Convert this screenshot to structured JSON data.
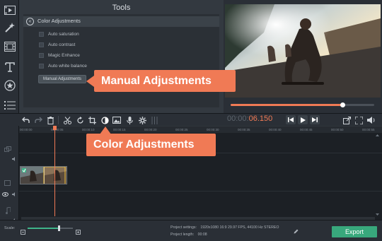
{
  "tools_panel": {
    "title": "Tools",
    "section_title": "Color Adjustments",
    "checkboxes": [
      {
        "label": "Auto saturation",
        "checked": false
      },
      {
        "label": "Auto contrast",
        "checked": false
      },
      {
        "label": "Magic Enhance",
        "checked": false
      },
      {
        "label": "Auto white balance",
        "checked": false
      }
    ],
    "manual_button_label": "Manual Adjustments"
  },
  "left_toolbar": {
    "icons": [
      "film-import-icon",
      "magic-wand-icon",
      "filmstrip-icon",
      "text-icon",
      "star-icon",
      "list-icon"
    ]
  },
  "preview": {
    "seek_progress": 0.78
  },
  "edit_toolbar": {
    "time_prefix": "00:00:",
    "time_value": "06.150"
  },
  "ruler": {
    "ticks": [
      "00:00:00",
      "00:00:05",
      "00:00:10",
      "00:00:15",
      "00:00:20",
      "00:00:25",
      "00:00:30",
      "00:00:35",
      "00:00:40",
      "00:00:45",
      "00:00:50",
      "00:00:55"
    ]
  },
  "bottom_bar": {
    "scale_label": "Scale:",
    "scale_level": 0.68,
    "project_settings_label": "Project settings:",
    "project_settings_value": "1920x1080 16:9 29.97 FPS, 44100 Hz STEREO",
    "project_length_label": "Project length:",
    "project_length_value": "00:08",
    "export_label": "Export"
  },
  "callouts": {
    "manual": "Manual Adjustments",
    "color": "Color Adjustments"
  },
  "colors": {
    "accent": "#f07a55",
    "export": "#38a87c",
    "background": "#1f2329"
  }
}
